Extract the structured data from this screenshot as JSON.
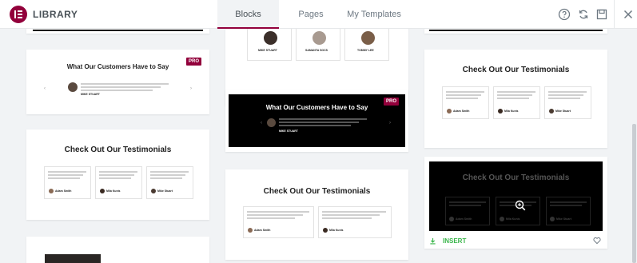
{
  "header": {
    "title": "LIBRARY",
    "tabs": [
      {
        "label": "Blocks",
        "active": true
      },
      {
        "label": "Pages",
        "active": false
      },
      {
        "label": "My Templates",
        "active": false
      }
    ],
    "icons": [
      "help-icon",
      "sync-icon",
      "save-icon",
      "close-icon"
    ]
  },
  "cards": {
    "customers_pro": {
      "title": "What Our Customers Have to Say",
      "badge": "PRO",
      "name": "MIKE STUART"
    },
    "customers_pro_dark": {
      "title": "What Our Customers Have to Say",
      "badge": "PRO",
      "name": "MIKE STUART"
    },
    "team_names": [
      "MIKE STUART",
      "SAMANTA SOCS",
      "TOMMY LEE"
    ],
    "testimonials_light_3": {
      "title": "Check Out Our Testimonials",
      "people": [
        "Adam Smith",
        "Mila Kunis",
        "Mike Stuart"
      ]
    },
    "testimonials_light_2": {
      "title": "Check Out Our Testimonials",
      "people": [
        "Adam Smith",
        "Mila Kunis"
      ]
    },
    "testimonials_top_right": {
      "title": "Check Out Our Testimonials",
      "people": [
        "Adam Smith",
        "Mila Kunis",
        "Mike Stuart"
      ]
    },
    "testimonials_dark": {
      "title": "Check Out Our Testimonials",
      "people": [
        "Adam Smith",
        "Mila Kunis",
        "Mike Stuart"
      ],
      "insert_label": "INSERT"
    }
  },
  "colors": {
    "brand": "#92003b",
    "insert": "#39b54a",
    "dark_bg": "#000000"
  }
}
